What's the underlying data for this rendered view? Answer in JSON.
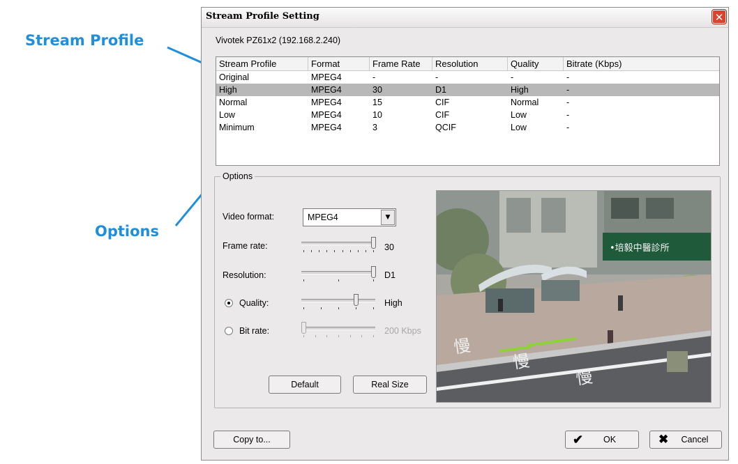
{
  "callouts": {
    "stream_profile": "Stream Profile",
    "options": "Options"
  },
  "dialog": {
    "title": "Stream Profile Setting",
    "device": "Vivotek PZ61x2 (192.168.2.240)"
  },
  "table": {
    "headers": [
      "Stream Profile",
      "Format",
      "Frame Rate",
      "Resolution",
      "Quality",
      "Bitrate (Kbps)"
    ],
    "rows": [
      [
        "Original",
        "MPEG4",
        "-",
        "-",
        "-",
        "-"
      ],
      [
        "High",
        "MPEG4",
        "30",
        "D1",
        "High",
        "-"
      ],
      [
        "Normal",
        "MPEG4",
        "15",
        "CIF",
        "Normal",
        "-"
      ],
      [
        "Low",
        "MPEG4",
        "10",
        "CIF",
        "Low",
        "-"
      ],
      [
        "Minimum",
        "MPEG4",
        "3",
        "QCIF",
        "Low",
        "-"
      ]
    ],
    "selected_row": "High"
  },
  "options": {
    "title": "Options",
    "video_format_label": "Video format:",
    "video_format_value": "MPEG4",
    "frame_rate_label": "Frame rate:",
    "frame_rate_value": "30",
    "frame_rate_level": 1.0,
    "resolution_label": "Resolution:",
    "resolution_value": "D1",
    "resolution_level": 1.0,
    "quality_label": "Quality:",
    "quality_value": "High",
    "quality_level": 0.75,
    "quality_selected": true,
    "bitrate_label": "Bit rate:",
    "bitrate_value": "200 Kbps",
    "bitrate_level": 0.0,
    "bitrate_selected": false,
    "default_button": "Default",
    "realsize_button": "Real Size"
  },
  "footer": {
    "copy_button": "Copy to...",
    "ok_button": "OK",
    "cancel_button": "Cancel"
  },
  "colors": {
    "callout": "#1e8fdd",
    "selected_row": "#b8b8b8",
    "close_button": "#d8442f"
  }
}
